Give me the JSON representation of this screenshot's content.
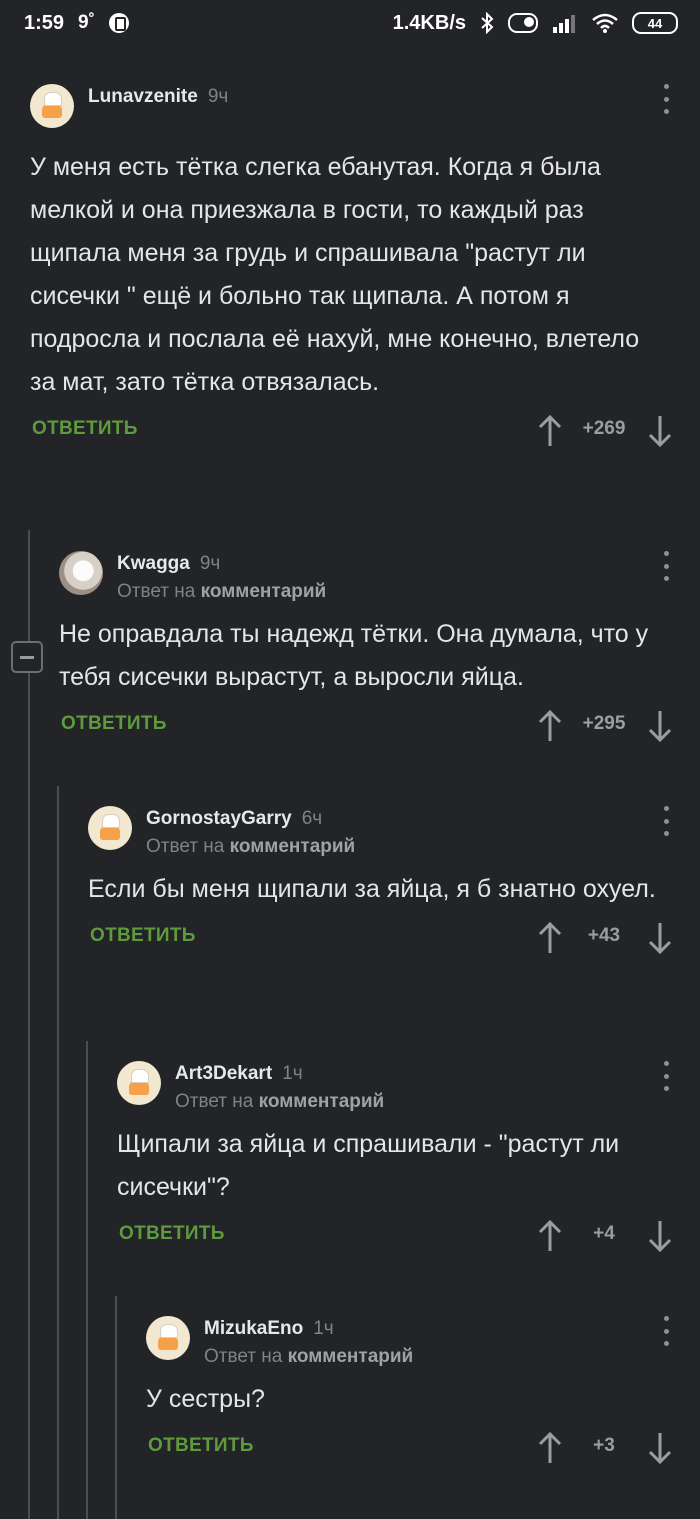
{
  "status": {
    "time": "1:59",
    "temp": "9˚",
    "speed": "1.4KB/s",
    "battery": "44"
  },
  "labels": {
    "reply_button": "ОТВЕТИТЬ",
    "reply_to_prefix": "Ответ на",
    "reply_to_link": "комментарий"
  },
  "comments": [
    {
      "author": "Lunavzenite",
      "time": "9ч",
      "text": "У меня есть тётка слегка ебанутая. Когда я была мелкой и она приезжала в гости, то каждый раз щипала меня за грудь и спрашивала \"растут ли сисечки \" ещё и больно так щипала. А потом я подросла и послала её нахуй, мне конечно, влетело за мат, зато тётка отвязалась.",
      "score": "+269"
    },
    {
      "author": "Kwagga",
      "time": "9ч",
      "text": "Не оправдала ты надежд тётки. Она думала, что у тебя сисечки вырастут, а выросли яйца.",
      "score": "+295"
    },
    {
      "author": "GornostayGarry",
      "time": "6ч",
      "text": "Если бы меня щипали за яйца, я б знатно охуел.",
      "score": "+43"
    },
    {
      "author": "Art3Dekart",
      "time": "1ч",
      "text": "Щипали за яйца и спрашивали - \"растут ли сисечки\"?",
      "score": "+4"
    },
    {
      "author": "MizukaEno",
      "time": "1ч",
      "text": "У сестры?",
      "score": "+3"
    }
  ]
}
